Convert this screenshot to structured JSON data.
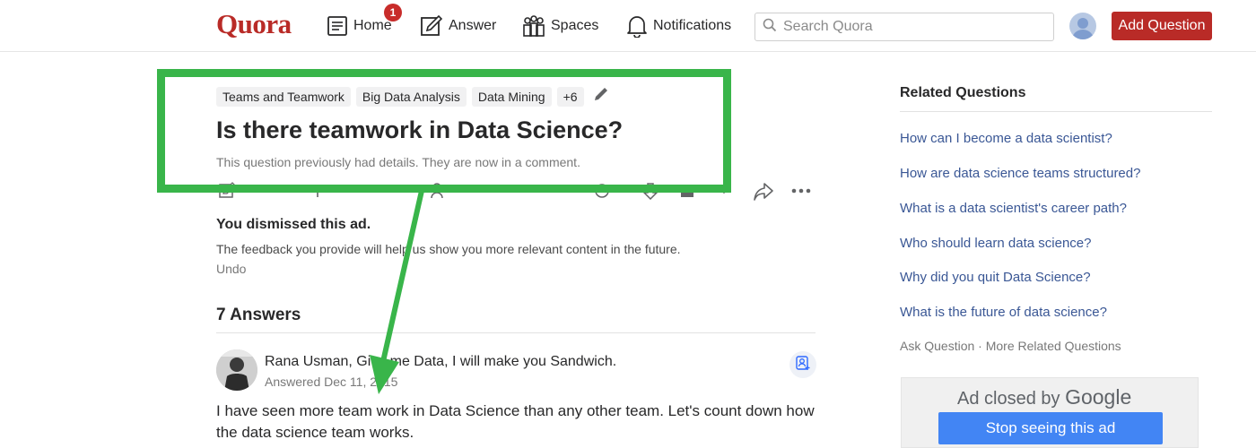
{
  "header": {
    "logo": "Quora",
    "nav": {
      "home": "Home",
      "home_badge": "1",
      "answer": "Answer",
      "spaces": "Spaces",
      "notifications": "Notifications"
    },
    "search_placeholder": "Search Quora",
    "add_question": "Add Question"
  },
  "question": {
    "topics": [
      "Teams and Teamwork",
      "Big Data Analysis",
      "Data Mining",
      "+6"
    ],
    "title": "Is there teamwork in Data Science?",
    "details": "This question previously had details. They are now in a comment."
  },
  "dismissed_ad": {
    "title": "You dismissed this ad.",
    "text": "The feedback you provide will help us show you more relevant content in the future.",
    "undo": "Undo"
  },
  "answers": {
    "count_label": "7 Answers",
    "first": {
      "author": "Rana Usman, Give me Data, I will make you Sandwich.",
      "date": "Answered Dec 11, 2015",
      "text": "I have seen more team work in Data Science than any other team. Let's count down how the data science team works."
    }
  },
  "sidebar": {
    "related_title": "Related Questions",
    "related": [
      "How can I become a data scientist?",
      "How are data science teams structured?",
      "What is a data scientist's career path?",
      "Who should learn data science?",
      "Why did you quit Data Science?",
      "What is the future of data science?"
    ],
    "ask_question": "Ask Question",
    "separator": " · ",
    "more_related": "More Related Questions",
    "ad_closed_prefix": "Ad closed by",
    "ad_closed_brand": "Google",
    "stop_ad": "Stop seeing this ad"
  },
  "colors": {
    "brand": "#b92b27",
    "annotation": "#39b54a",
    "ad_button": "#4285f4"
  }
}
